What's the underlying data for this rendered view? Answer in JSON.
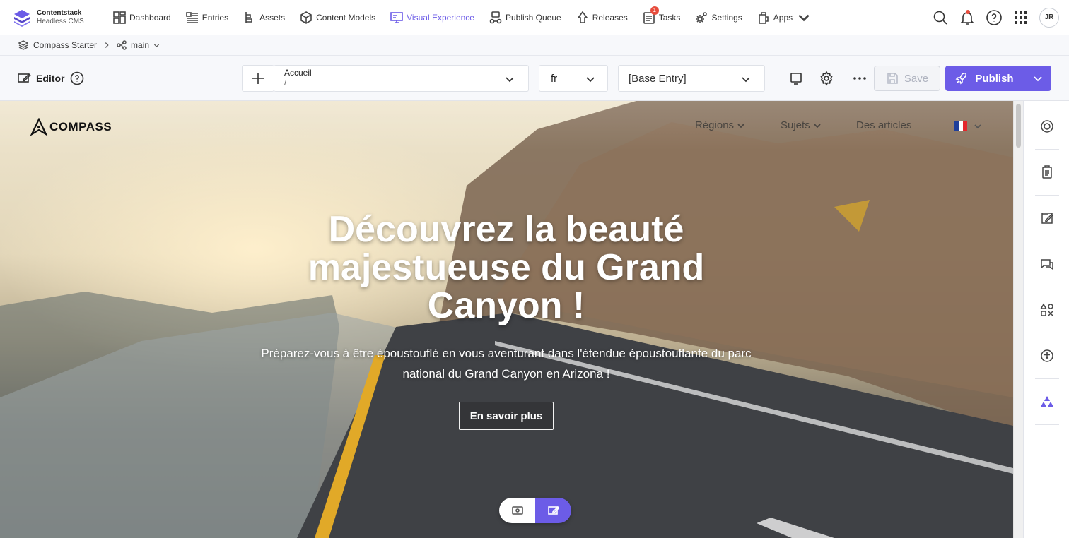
{
  "brand": {
    "name": "Contentstack",
    "sub": "Headless CMS"
  },
  "nav": [
    {
      "label": "Dashboard",
      "icon": "dashboard-icon"
    },
    {
      "label": "Entries",
      "icon": "entries-icon"
    },
    {
      "label": "Assets",
      "icon": "assets-icon"
    },
    {
      "label": "Content Models",
      "icon": "cube-icon"
    },
    {
      "label": "Visual Experience",
      "icon": "visual-experience-icon",
      "active": true
    },
    {
      "label": "Publish Queue",
      "icon": "publish-queue-icon"
    },
    {
      "label": "Releases",
      "icon": "releases-icon"
    },
    {
      "label": "Tasks",
      "icon": "tasks-icon",
      "badge": "1"
    },
    {
      "label": "Settings",
      "icon": "gear-icon"
    },
    {
      "label": "Apps",
      "icon": "apps-icon"
    }
  ],
  "user": {
    "initials": "JR"
  },
  "breadcrumb": {
    "stack": "Compass Starter",
    "branch": "main"
  },
  "editor": {
    "label": "Editor",
    "entry_title": "Accueil",
    "entry_url": "/",
    "locale": "fr",
    "variant": "[Base Entry]",
    "save_label": "Save",
    "publish_label": "Publish"
  },
  "site": {
    "logo": "COMPASS",
    "nav": [
      "Régions",
      "Sujets",
      "Des articles"
    ],
    "hero_title": "Découvrez la beauté majestueuse du Grand Canyon !",
    "hero_text": "Préparez-vous à être époustouflé en vous aventurant dans l'étendue époustouflante du parc national du Grand Canyon en Arizona !",
    "hero_button": "En savoir plus"
  },
  "colors": {
    "accent": "#6c5ce7",
    "badge": "#e74c3c"
  }
}
